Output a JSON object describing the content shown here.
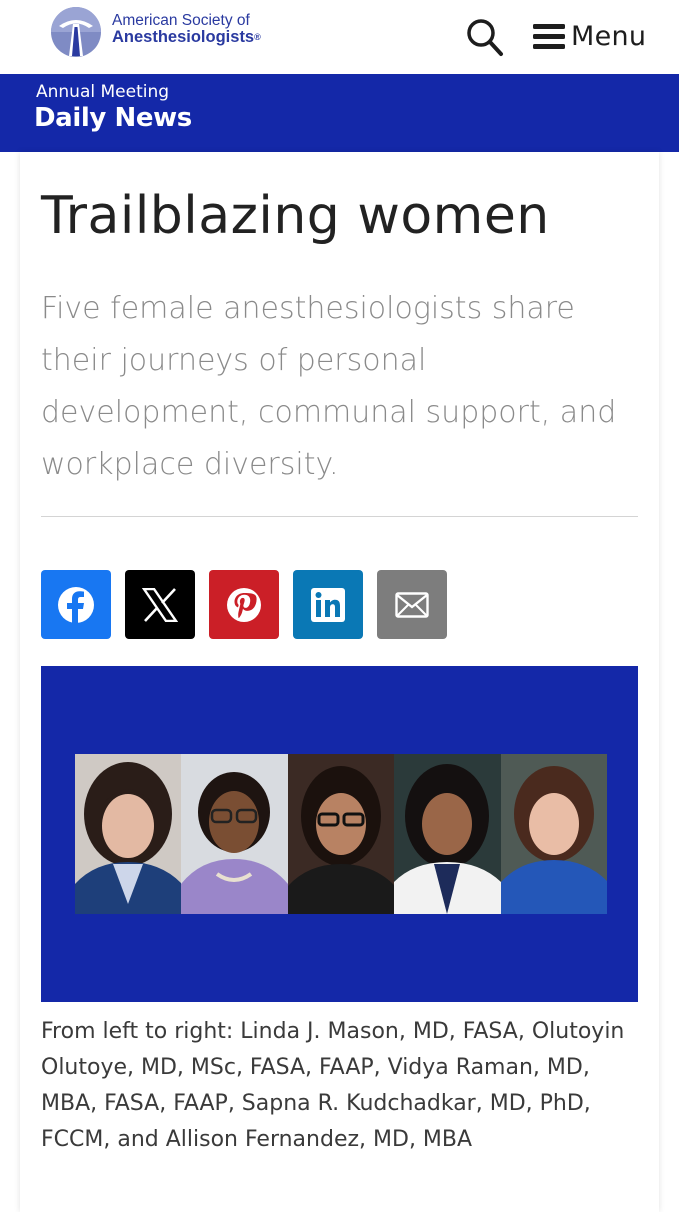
{
  "header": {
    "org_line1": "American Society of",
    "org_line2": "Anesthesiologists",
    "org_mark": "®",
    "menu_label": "Menu"
  },
  "banner": {
    "subtitle": "Annual Meeting",
    "title": "Daily News",
    "color": "#1428a8"
  },
  "article": {
    "title": "Trailblazing women",
    "dek": "Five female anesthesiologists share their journeys of personal development, communal support, and workplace diversity.",
    "caption": "From left to right: Linda J. Mason, MD, FASA, Olutoyin Olutoye, MD, MSc, FASA, FAAP, Vidya Raman, MD, MBA, FASA, FAAP, Sapna R. Kudchadkar, MD, PhD, FCCM, and Allison Fernandez, MD, MBA"
  },
  "share_buttons": [
    {
      "name": "facebook",
      "icon": "facebook-icon",
      "color": "#1877f2"
    },
    {
      "name": "x",
      "icon": "x-icon",
      "color": "#000000"
    },
    {
      "name": "pinterest",
      "icon": "pinterest-icon",
      "color": "#cb1f27"
    },
    {
      "name": "linkedin",
      "icon": "linkedin-icon",
      "color": "#0a78b5"
    },
    {
      "name": "email",
      "icon": "envelope-icon",
      "color": "#7d7d7d"
    }
  ],
  "photo": {
    "background": "#1428a8",
    "portraits": 5
  }
}
